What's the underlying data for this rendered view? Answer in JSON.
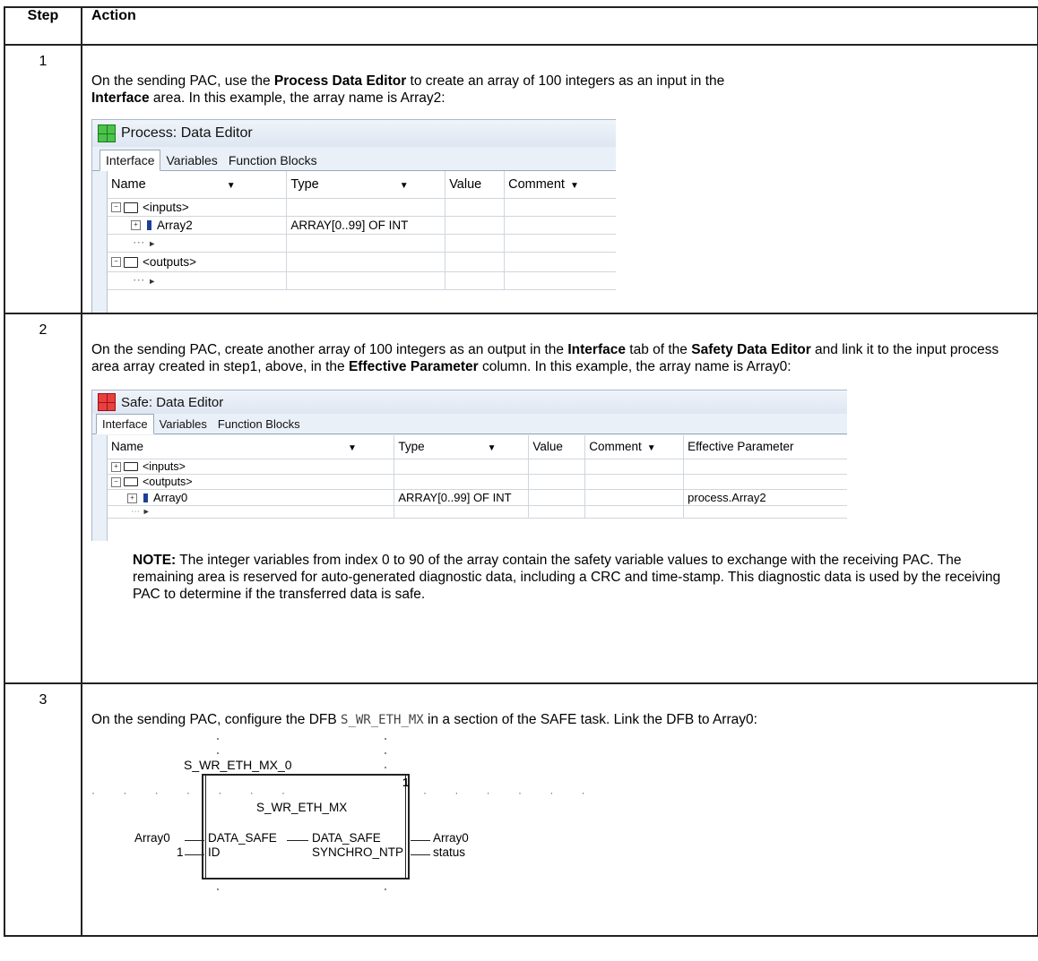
{
  "table": {
    "header": {
      "step": "Step",
      "action": "Action"
    },
    "rows": [
      {
        "step": "1",
        "text": {
          "a": "On the sending PAC, use the ",
          "b1": "Process Data Editor",
          "c": " to create an array of 100 integers as an input in the ",
          "b2": "Interface",
          "d": " area. In this example, the array name is Array2:"
        },
        "window": {
          "title": "Process: Data Editor",
          "tabs": [
            "Interface",
            "Variables",
            "Function Blocks"
          ],
          "columns": [
            "Name",
            "Type",
            "Value",
            "Comment"
          ],
          "rows": [
            {
              "name": "<inputs>",
              "type": ""
            },
            {
              "name": "Array2",
              "type": "ARRAY[0..99] OF INT"
            },
            {
              "name": "",
              "type": ""
            },
            {
              "name": "<outputs>",
              "type": ""
            },
            {
              "name": "",
              "type": ""
            }
          ]
        }
      },
      {
        "step": "2",
        "text": {
          "a": "On the sending PAC, create another array of 100 integers as an output in the ",
          "b1": "Interface",
          "c": " tab of the ",
          "b2": "Safety Data Editor",
          "d": " and link it to the input process area array created in step1, above, in the ",
          "b3": "Effective Parameter",
          "e": " column. In this example, the array name is Array0:"
        },
        "window": {
          "title": "Safe: Data Editor",
          "tabs": [
            "Interface",
            "Variables",
            "Function Blocks"
          ],
          "columns": [
            "Name",
            "Type",
            "Value",
            "Comment",
            "Effective Parameter"
          ],
          "rows": [
            {
              "name": "<inputs>",
              "type": "",
              "effective": ""
            },
            {
              "name": "<outputs>",
              "type": "",
              "effective": ""
            },
            {
              "name": "Array0",
              "type": "ARRAY[0..99] OF INT",
              "effective": "process.Array2"
            },
            {
              "name": "",
              "type": "",
              "effective": ""
            }
          ]
        },
        "note": {
          "label": "NOTE:",
          "text": " The integer variables from index 0 to 90 of the array contain the safety variable values to exchange with the receiving PAC. The remaining area is reserved for auto-generated diagnostic data, including a CRC and time-stamp. This diagnostic data is used by the receiving PAC to determine if the transferred data is safe."
        }
      },
      {
        "step": "3",
        "text": {
          "a": "On the sending PAC, configure the DFB ",
          "code": "S_WR_ETH_MX",
          "b": " in a section of the SAFE task. Link the DFB to Array0:"
        },
        "dfb": {
          "instance": "S_WR_ETH_MX_0",
          "type": "S_WR_ETH_MX",
          "number": "1",
          "in1_var": "Array0",
          "in1_pin": "DATA_SAFE",
          "in2_var": "1",
          "in2_pin": "ID",
          "out1_pin": "DATA_SAFE",
          "out1_var": "Array0",
          "out2_pin": "SYNCHRO_NTP",
          "out2_var": "status"
        }
      }
    ]
  }
}
